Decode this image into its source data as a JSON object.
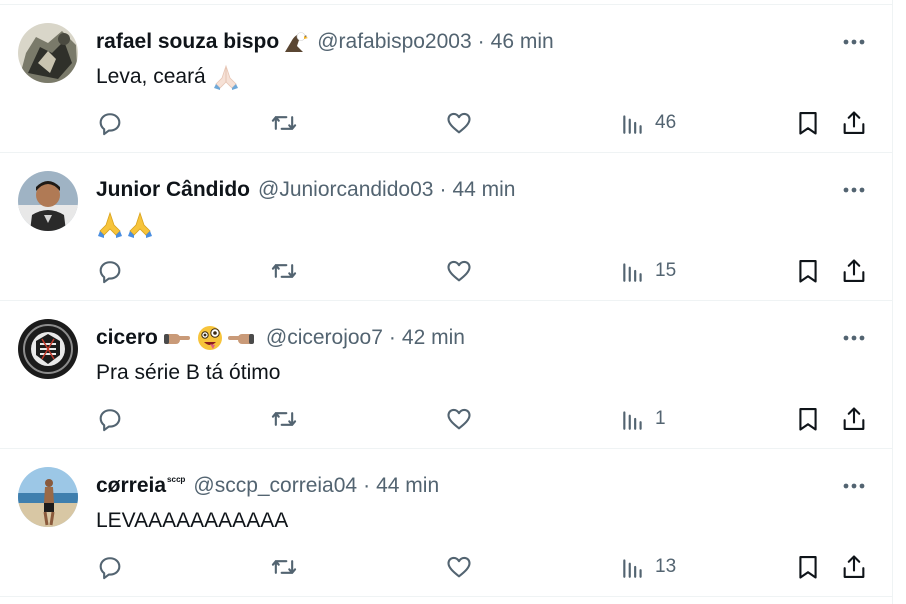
{
  "colors": {
    "text": "#0f1419",
    "secondary": "#536471",
    "border": "#eff3f4"
  },
  "separator": "·",
  "tweets": [
    {
      "name": "rafael souza bispo",
      "name_badge": "eagle-emoji",
      "handle": "@rafabispo2003",
      "time": "46 min",
      "text": "Leva, ceará",
      "text_emoji": "folded-hands-light-emoji",
      "views": "46"
    },
    {
      "name": "Junior Cândido",
      "handle": "@Juniorcandido03",
      "time": "44 min",
      "text": "",
      "text_emoji": "folded-hands-emoji-x2",
      "views": "15"
    },
    {
      "name": "cicero",
      "name_badge": "pointing-right-zany-face-pointing-left-emoji",
      "handle": "@cicerojoo7",
      "time": "42 min",
      "text": "Pra série B tá ótimo",
      "views": "1"
    },
    {
      "name": "cørreia",
      "name_suffix": "ˢᶜᶜᵖ",
      "handle": "@sccp_correia04",
      "time": "44 min",
      "text": "LEVAAAAAAAAAAA",
      "views": "13"
    }
  ]
}
